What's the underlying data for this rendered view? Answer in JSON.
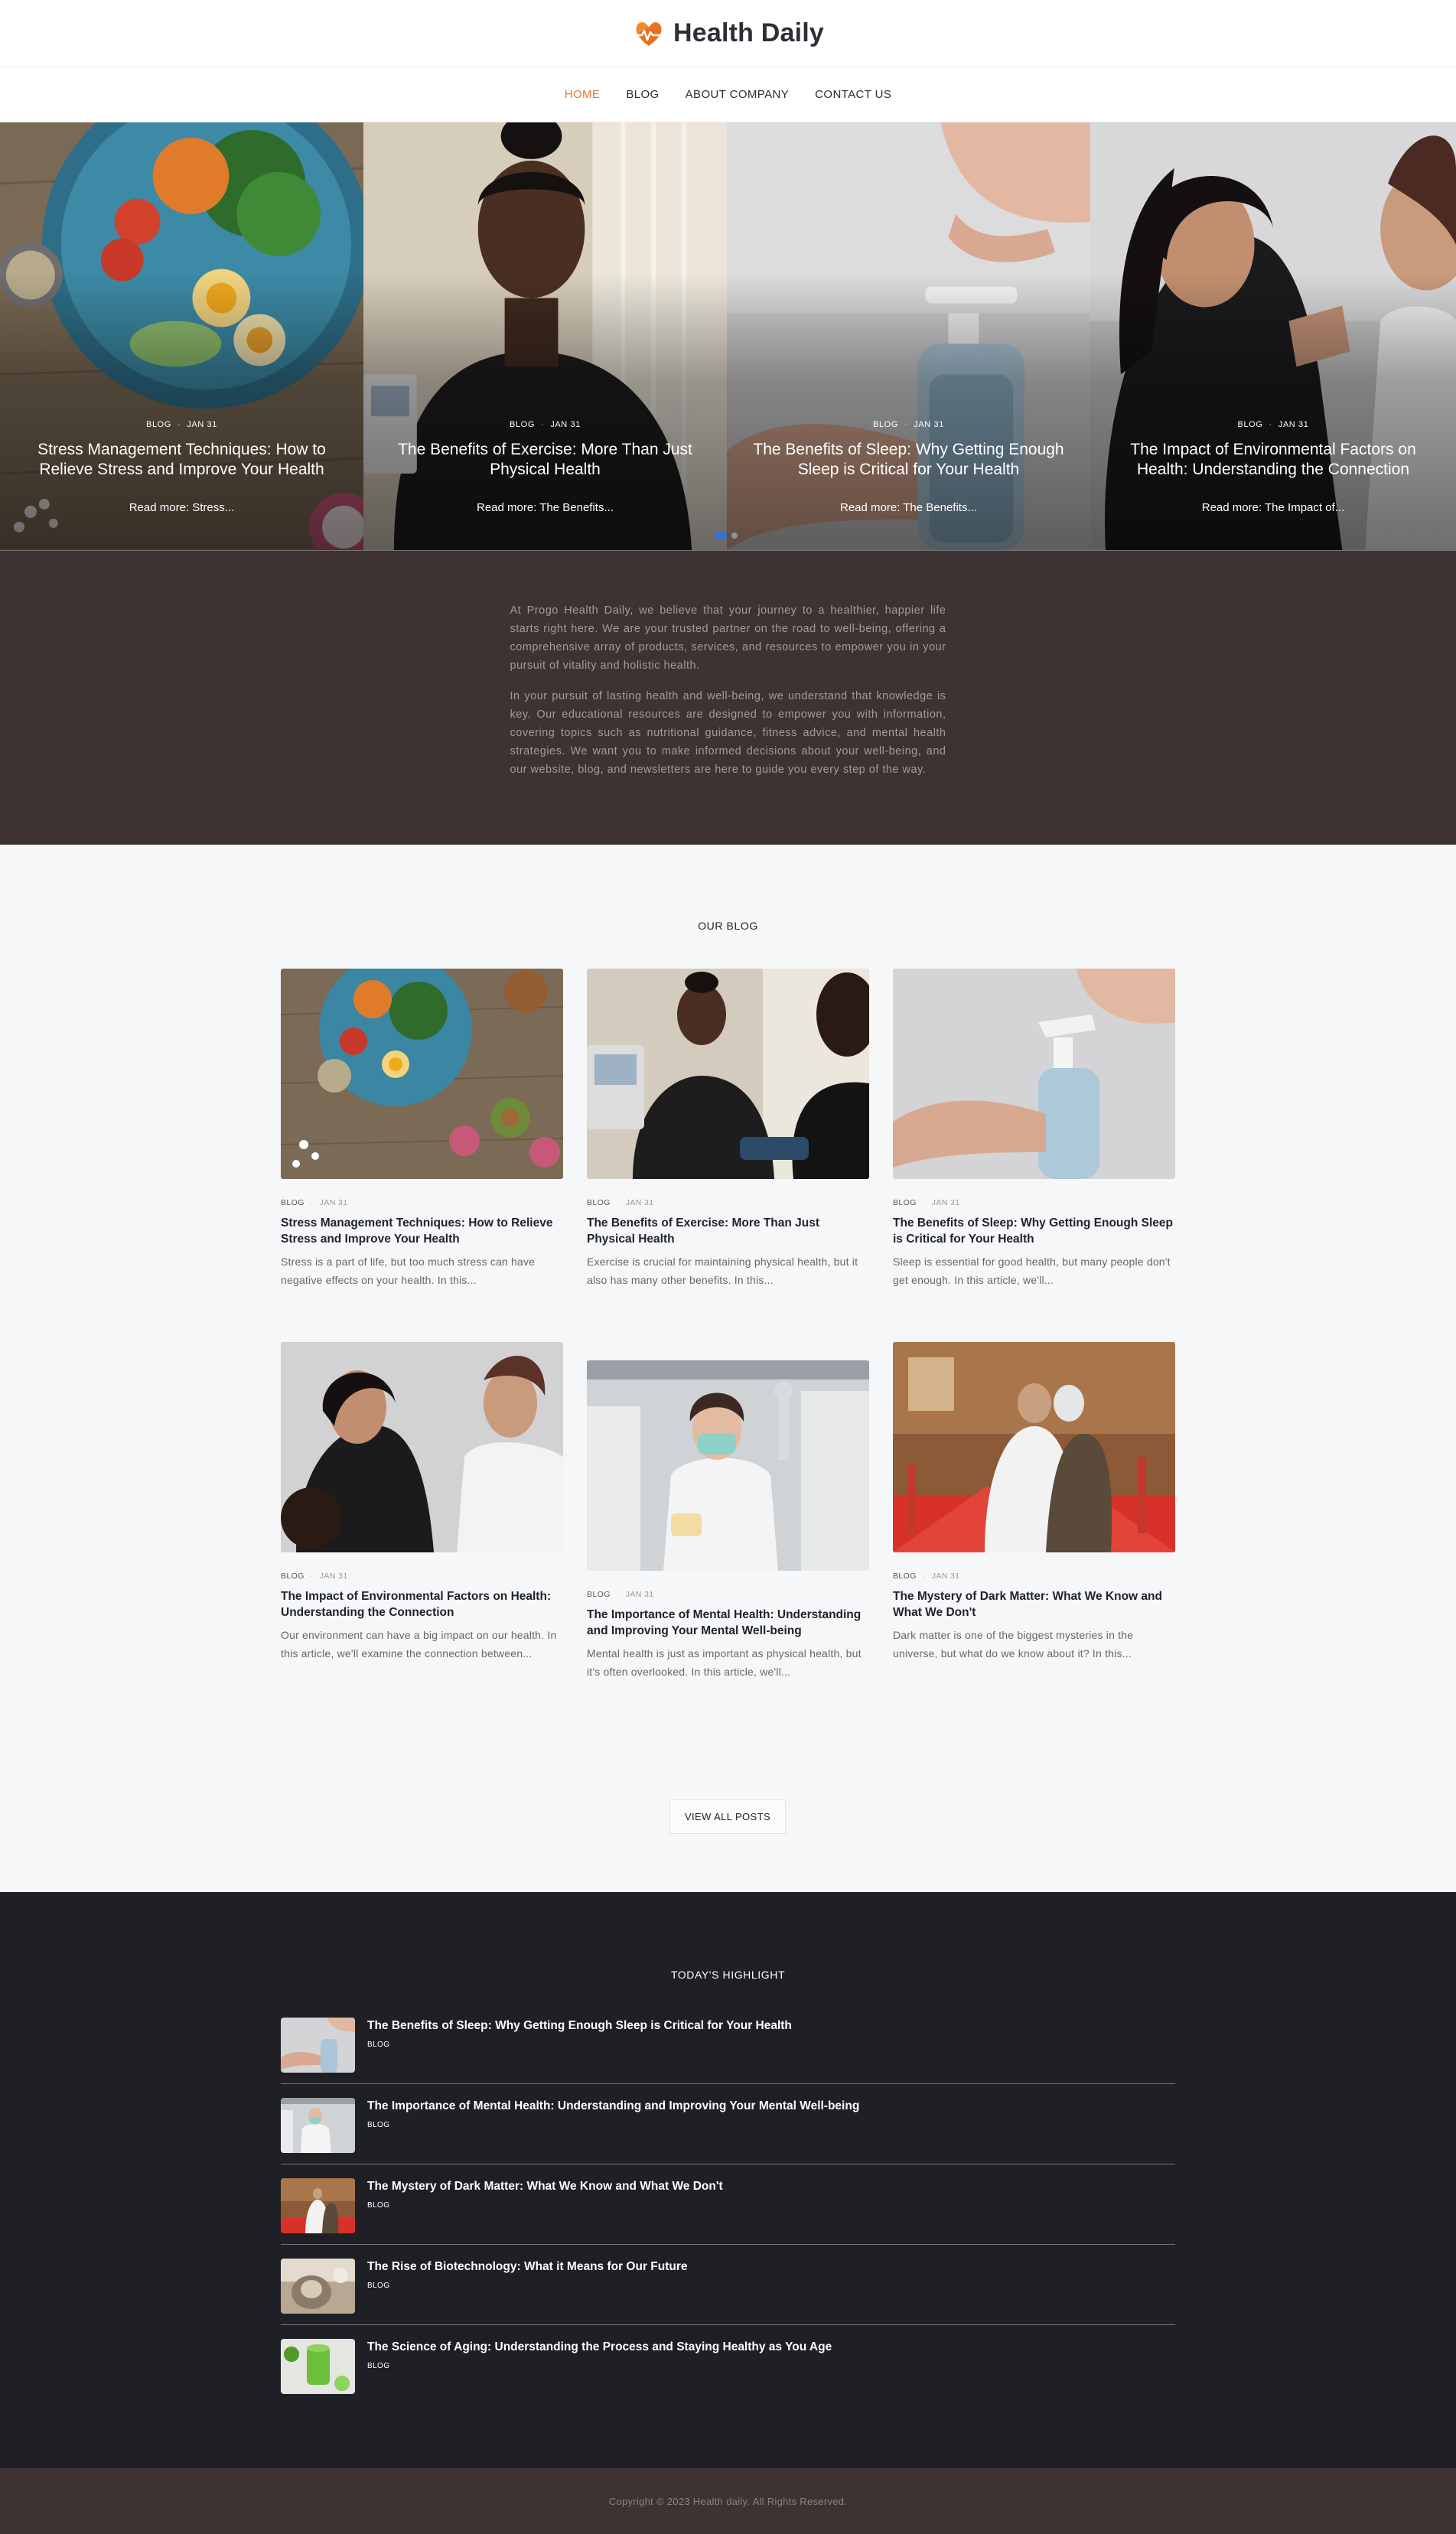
{
  "brand": {
    "name": "Health Daily",
    "logo_icon": "heart-pulse-logo",
    "accent": "#e8762d"
  },
  "nav": {
    "items": [
      {
        "label": "HOME",
        "active": true
      },
      {
        "label": "BLOG",
        "active": false
      },
      {
        "label": "ABOUT COMPANY",
        "active": false
      },
      {
        "label": "CONTACT US",
        "active": false
      }
    ]
  },
  "hero": {
    "slides": [
      {
        "category": "BLOG",
        "date": "JAN 31",
        "title": "Stress Management Techniques: How to Relieve Stress and Improve Your Health",
        "more": "Read more: Stress..."
      },
      {
        "category": "BLOG",
        "date": "JAN 31",
        "title": "The Benefits of Exercise: More Than Just Physical Health",
        "more": "Read more: The Benefits..."
      },
      {
        "category": "BLOG",
        "date": "JAN 31",
        "title": "The Benefits of Sleep: Why Getting Enough Sleep is Critical for Your Health",
        "more": "Read more: The Benefits..."
      },
      {
        "category": "BLOG",
        "date": "JAN 31",
        "title": "The Impact of Environmental Factors on Health: Understanding the Connection",
        "more": "Read more: The Impact of..."
      }
    ],
    "active_dot": 0,
    "dot_color": "#2a73e8"
  },
  "about": {
    "paragraphs": [
      "At Progo Health Daily, we believe that your journey to a healthier, happier life starts right here. We are your trusted partner on the road to well-being, offering a comprehensive array of products, services, and resources to empower you in your pursuit of vitality and holistic health.",
      "In your pursuit of lasting health and well-being, we understand that knowledge is key. Our educational resources are designed to empower you with information, covering topics such as nutritional guidance, fitness advice, and mental health strategies. We want you to make informed decisions about your well-being, and our website, blog, and newsletters are here to guide you every step of the way."
    ]
  },
  "blog": {
    "section_title": "OUR BLOG",
    "posts": [
      {
        "category": "BLOG",
        "date": "JAN 31",
        "title": "Stress Management Techniques: How to Relieve Stress and Improve Your Health",
        "excerpt": "Stress is a part of life, but too much stress can have negative effects on your health. In this..."
      },
      {
        "category": "BLOG",
        "date": "JAN 31",
        "title": "The Benefits of Exercise: More Than Just Physical Health",
        "excerpt": "Exercise is crucial for maintaining physical health, but it also has many other benefits. In this..."
      },
      {
        "category": "BLOG",
        "date": "JAN 31",
        "title": "The Benefits of Sleep: Why Getting Enough Sleep is Critical for Your Health",
        "excerpt": "Sleep is essential for good health, but many people don't get enough. In this article, we'll..."
      },
      {
        "category": "BLOG",
        "date": "JAN 31",
        "title": "The Impact of Environmental Factors on Health: Understanding the Connection",
        "excerpt": "Our environment can have a big impact on our health. In this article, we'll examine the connection between..."
      },
      {
        "category": "BLOG",
        "date": "JAN 31",
        "title": "The Importance of Mental Health: Understanding and Improving Your Mental Well-being",
        "excerpt": "Mental health is just as important as physical health, but it's often overlooked. In this article, we'll..."
      },
      {
        "category": "BLOG",
        "date": "JAN 31",
        "title": "The Mystery of Dark Matter: What We Know and What We Don't",
        "excerpt": "Dark matter is one of the biggest mysteries in the universe, but what do we know about it? In this..."
      }
    ],
    "view_all": "VIEW ALL POSTS"
  },
  "highlights": {
    "section_title": "TODAY'S HIGHLIGHT",
    "items": [
      {
        "title": "The Benefits of Sleep: Why Getting Enough Sleep is Critical for Your Health",
        "category": "BLOG"
      },
      {
        "title": "The Importance of Mental Health: Understanding and Improving Your Mental Well-being",
        "category": "BLOG"
      },
      {
        "title": "The Mystery of Dark Matter: What We Know and What We Don't",
        "category": "BLOG"
      },
      {
        "title": "The Rise of Biotechnology: What it Means for Our Future",
        "category": "BLOG"
      },
      {
        "title": "The Science of Aging: Understanding the Process and Staying Healthy as You Age",
        "category": "BLOG"
      }
    ]
  },
  "footer": {
    "copyright": "Copyright © 2023 Health daily. All Rights Reserved."
  }
}
